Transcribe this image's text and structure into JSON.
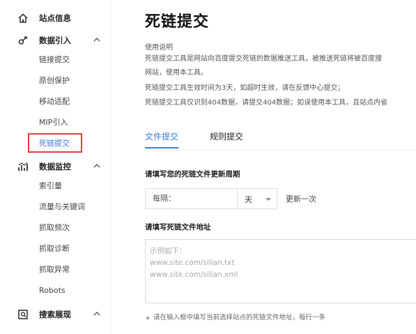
{
  "sidebar": {
    "groups": [
      {
        "label": "站点信息",
        "icon": "home-icon",
        "items": []
      },
      {
        "label": "数据引入",
        "icon": "data-import-icon",
        "expanded": true,
        "items": [
          "链接提交",
          "原创保护",
          "移动适配",
          "MIP引入",
          "死链提交"
        ]
      },
      {
        "label": "数据监控",
        "icon": "chart-icon",
        "expanded": true,
        "items": [
          "索引量",
          "流量与关键词",
          "抓取频次",
          "抓取诊断",
          "抓取异常",
          "Robots"
        ]
      },
      {
        "label": "搜索展现",
        "icon": "search-display-icon",
        "expanded": true,
        "items": []
      }
    ],
    "active_item": "死链提交"
  },
  "main": {
    "title": "死链提交",
    "usage_label": "使用说明",
    "description": [
      "死链提交工具是网站向百度提交死链的数据推送工具，被推送死链将被百度搜",
      "网站，使用本工具。",
      "死链提交工具生效时间为3天，如超时生效，请在反馈中心提交；",
      "死链提交工具仅识别404数据，请提交404数据；如误使用本工具，且站点内省"
    ],
    "tabs": [
      {
        "label": "文件提交",
        "active": true
      },
      {
        "label": "规则提交",
        "active": false
      }
    ],
    "period": {
      "section_label": "请填写您的死链文件更新周期",
      "input_label": "每隔：",
      "unit": "天",
      "suffix": "更新一次"
    },
    "file_url": {
      "section_label": "请填写死链文件地址",
      "placeholder_lines": [
        "示例如下：",
        "www.site.com/silian.txt",
        "www.site.com/silian.xml"
      ]
    },
    "hint": "请在输入框中填写当前选择站点的死链文件地址，每行一条"
  },
  "colors": {
    "accent": "#3a7bd5",
    "highlight_border": "#e23b3b"
  }
}
